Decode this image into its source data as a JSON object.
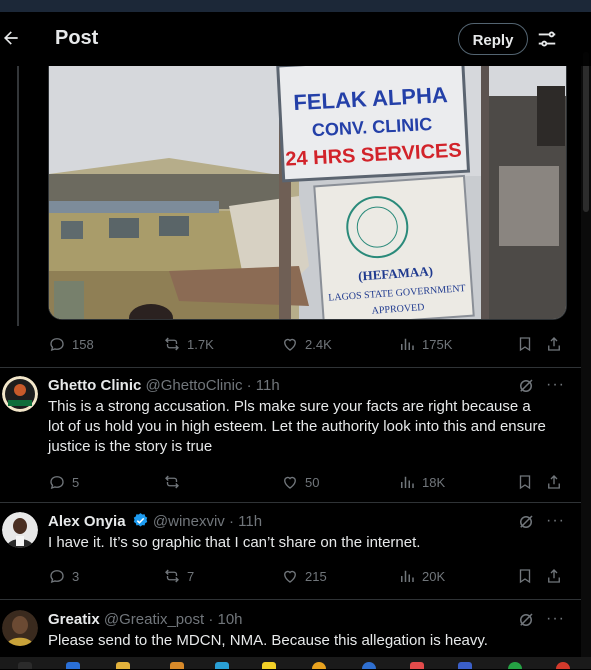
{
  "header": {
    "title": "Post",
    "reply_label": "Reply"
  },
  "post_image": {
    "sign1": {
      "line1": "FELAK ALPHA",
      "line2": "CONV. CLINIC",
      "line3": "24 HRS SERVICES"
    },
    "sign2": {
      "line1": "(HEFAMAA)",
      "line2": "LAGOS STATE GOVERNMENT",
      "line3": "APPROVED"
    }
  },
  "post_actions": {
    "replies": "158",
    "reposts": "1.7K",
    "likes": "2.4K",
    "views": "175K"
  },
  "replies": [
    {
      "name": "Ghetto Clinic",
      "handle": "@GhettoClinic",
      "dot": "·",
      "time": "11h",
      "text": "This is a strong accusation. Pls make sure your facts are right because a lot of us hold you in high esteem. Let the authority look into this and ensure justice is the story is true",
      "replies": "5",
      "reposts": "",
      "likes": "50",
      "views": "18K"
    },
    {
      "name": "Alex Onyia",
      "handle": "@winexviv",
      "dot": "·",
      "time": "11h",
      "text": "I have it. It’s so graphic that I can’t share on the internet.",
      "replies": "3",
      "reposts": "7",
      "likes": "215",
      "views": "20K"
    },
    {
      "name": "Greatix",
      "handle": "@Greatix_post",
      "dot": "·",
      "time": "10h",
      "text": "Please send to the MDCN, NMA. Because this allegation is heavy."
    }
  ],
  "more_glyph": "···",
  "colors": {
    "background": "#000000",
    "text": "#e7e9ea",
    "muted": "#71767b",
    "verified": "#1d9bf0",
    "divider": "#2f3336"
  }
}
